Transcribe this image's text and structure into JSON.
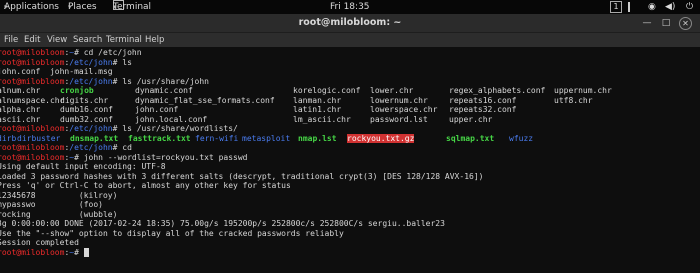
{
  "topbar": {
    "applications": "Applications",
    "places": "Places",
    "terminal": "Terminal",
    "time": "Fri 18:35",
    "workspace": "1"
  },
  "window": {
    "title": "root@milobloom: ~"
  },
  "menu": [
    "File",
    "Edit",
    "View",
    "Search",
    "Terminal",
    "Help"
  ],
  "terminal": {
    "user": "root@milobloom",
    "lines": [
      {
        "path": "~",
        "cmd": "cd /etc/john"
      },
      {
        "path": "/etc/john",
        "cmd": "ls"
      },
      {
        "out": "john.conf  john-mail.msg"
      },
      {
        "path": "/etc/john",
        "cmd": "ls /usr/share/john"
      },
      {
        "cells": [
          {
            "t": "alnum.chr",
            "c": ""
          },
          {
            "t": "cronjob",
            "c": "green"
          },
          {
            "t": "dynamic.conf",
            "c": ""
          },
          {
            "t": "korelogic.conf",
            "c": ""
          },
          {
            "t": "lower.chr",
            "c": ""
          },
          {
            "t": "regex_alphabets.conf",
            "c": ""
          },
          {
            "t": "uppernum.chr",
            "c": ""
          }
        ]
      },
      {
        "cells": [
          {
            "t": "alnumspace.chr",
            "c": ""
          },
          {
            "t": "digits.chr",
            "c": ""
          },
          {
            "t": "dynamic_flat_sse_formats.conf",
            "c": ""
          },
          {
            "t": "lanman.chr",
            "c": ""
          },
          {
            "t": "lowernum.chr",
            "c": ""
          },
          {
            "t": "repeats16.conf",
            "c": ""
          },
          {
            "t": "utf8.chr",
            "c": ""
          }
        ]
      },
      {
        "cells": [
          {
            "t": "alpha.chr",
            "c": ""
          },
          {
            "t": "dumb16.conf",
            "c": ""
          },
          {
            "t": "john.conf",
            "c": ""
          },
          {
            "t": "latin1.chr",
            "c": ""
          },
          {
            "t": "lowerspace.chr",
            "c": ""
          },
          {
            "t": "repeats32.conf",
            "c": ""
          }
        ]
      },
      {
        "cells": [
          {
            "t": "ascii.chr",
            "c": ""
          },
          {
            "t": "dumb32.conf",
            "c": ""
          },
          {
            "t": "john.local.conf",
            "c": ""
          },
          {
            "t": "lm_ascii.chr",
            "c": ""
          },
          {
            "t": "password.lst",
            "c": ""
          },
          {
            "t": "upper.chr",
            "c": ""
          }
        ]
      },
      {
        "path": "/etc/john",
        "cmd": "ls /usr/share/wordlists/"
      },
      {
        "cells": [
          {
            "t": "dirb",
            "c": "blue"
          },
          {
            "t": "dirbuster",
            "c": "blue"
          },
          {
            "t": "dnsmap.txt",
            "c": "green"
          },
          {
            "t": "fasttrack.txt",
            "c": "green"
          },
          {
            "t": "fern-wifi",
            "c": "blue"
          },
          {
            "t": "metasploit",
            "c": "blue"
          },
          {
            "t": "nmap.lst",
            "c": "green"
          },
          {
            "t": "rockyou.txt.gz",
            "c": "hl"
          },
          {
            "t": "sqlmap.txt",
            "c": "green"
          },
          {
            "t": "wfuzz",
            "c": "blue"
          }
        ]
      },
      {
        "path": "/etc/john",
        "cmd": "cd"
      },
      {
        "path": "~",
        "cmd": "john --wordlist=rockyou.txt passwd"
      },
      {
        "out": "Using default input encoding: UTF-8"
      },
      {
        "out": "Loaded 3 password hashes with 3 different salts (descrypt, traditional crypt(3) [DES 128/128 AVX-16])"
      },
      {
        "out": "Press 'q' or Ctrl-C to abort, almost any other key for status"
      },
      {
        "out": "12345678         (kilroy)"
      },
      {
        "out": "mypasswo         (foo)"
      },
      {
        "out": "rocking          (wubble)"
      },
      {
        "out": "3g 0:00:00:00 DONE (2017-02-24 18:35) 75.00g/s 195200p/s 252800c/s 252800C/s sergiu..baller23"
      },
      {
        "out": "Use the \"--show\" option to display all of the cracked passwords reliably"
      },
      {
        "out": "Session completed"
      },
      {
        "path": "~",
        "cmd": ""
      }
    ]
  }
}
